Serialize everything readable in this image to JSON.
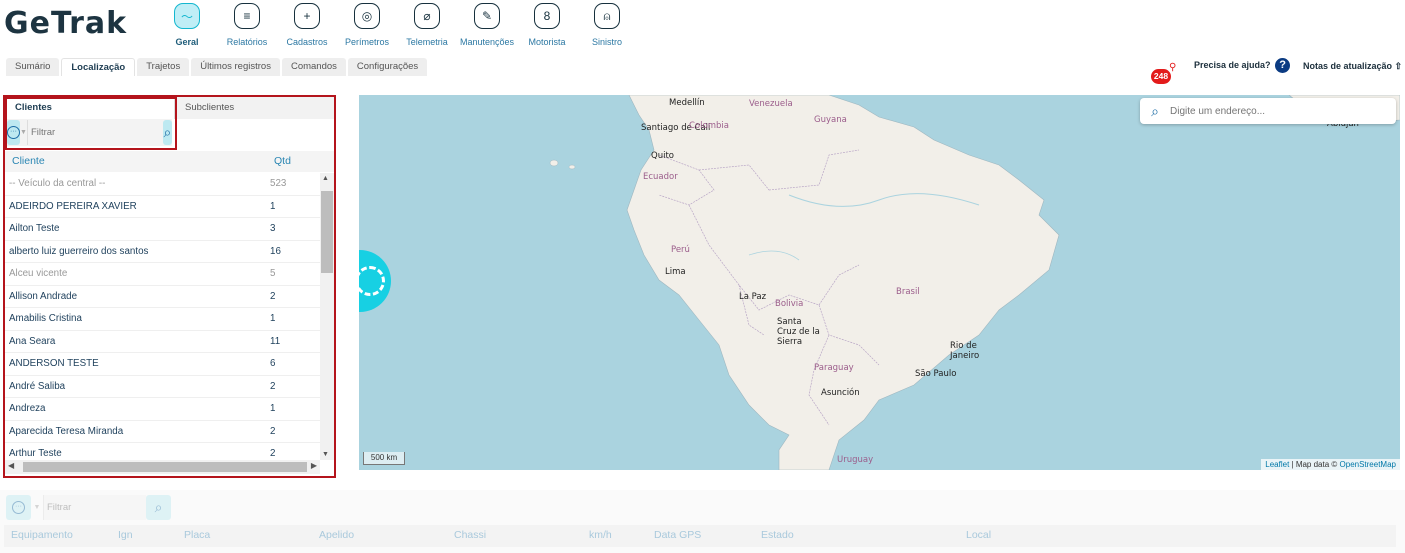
{
  "brand": {
    "logo_text": "GeTrak"
  },
  "nav": [
    {
      "label": "Geral",
      "icon": "dashboard-icon",
      "glyph": "〜",
      "active": true
    },
    {
      "label": "Relatórios",
      "icon": "report-icon",
      "glyph": "≡"
    },
    {
      "label": "Cadastros",
      "icon": "folder-add-icon",
      "glyph": "+"
    },
    {
      "label": "Perímetros",
      "icon": "target-icon",
      "glyph": "◎"
    },
    {
      "label": "Telemetria",
      "icon": "gauge-icon",
      "glyph": "⌀"
    },
    {
      "label": "Manutenções",
      "icon": "wrench-icon",
      "glyph": "✎"
    },
    {
      "label": "Motorista",
      "icon": "driver-icon",
      "glyph": "8"
    },
    {
      "label": "Sinistro",
      "icon": "alarm-icon",
      "glyph": "⍝"
    }
  ],
  "tabs": [
    "Sumário",
    "Localização",
    "Trajetos",
    "Últimos registros",
    "Comandos",
    "Configurações"
  ],
  "active_tab": "Localização",
  "header": {
    "notification_count": "248",
    "help_label": "Precisa de ajuda?",
    "help_glyph": "?",
    "release_notes_label": "Notas de atualização"
  },
  "clients_panel": {
    "tabs": [
      "Clientes",
      "Subclientes"
    ],
    "filter_placeholder": "Filtrar",
    "columns": [
      "Cliente",
      "Qtd"
    ],
    "rows": [
      {
        "name": "-- Veículo da central --",
        "qtd": "523",
        "muted": true
      },
      {
        "name": "ADEIRDO PEREIRA XAVIER",
        "qtd": "1"
      },
      {
        "name": "Ailton Teste",
        "qtd": "3"
      },
      {
        "name": "alberto luiz guerreiro dos santos",
        "qtd": "16"
      },
      {
        "name": "Alceu vicente",
        "qtd": "5",
        "muted": true
      },
      {
        "name": "Allison Andrade",
        "qtd": "2"
      },
      {
        "name": "Amabilis Cristina",
        "qtd": "1"
      },
      {
        "name": "Ana Seara",
        "qtd": "11"
      },
      {
        "name": "ANDERSON TESTE",
        "qtd": "6"
      },
      {
        "name": "André Saliba",
        "qtd": "2"
      },
      {
        "name": "Andreza",
        "qtd": "1"
      },
      {
        "name": "Aparecida Teresa Miranda",
        "qtd": "2"
      },
      {
        "name": "Arthur Teste",
        "qtd": "2"
      }
    ]
  },
  "map": {
    "search_placeholder": "Digite um endereço...",
    "scale_label": "500 km",
    "attribution": {
      "leaflet": "Leaflet",
      "sep": " | Map data © ",
      "osm": "OpenStreetMap"
    },
    "labels": {
      "country": [
        "Venezuela",
        "Guyana",
        "Colombia",
        "Ecuador",
        "Perú",
        "Bolivia",
        "Brasil",
        "Paraguay",
        "Uruguay"
      ],
      "city": [
        "Medellín",
        "Santiago de Cali",
        "Quito",
        "Lima",
        "La Paz",
        "Santa Cruz de la Sierra",
        "Rio de Janeiro",
        "São Paulo",
        "Asunción",
        "Abidjan"
      ]
    },
    "colors": {
      "water": "#aad3df",
      "land": "#f2efe9",
      "cluster": "#17d0e3",
      "accent": "#b4141c"
    }
  },
  "vehicles_table": {
    "filter_placeholder": "Filtrar",
    "columns": [
      "Equipamento",
      "Ign",
      "Placa",
      "Apelido",
      "Chassi",
      "km/h",
      "Data GPS",
      "Estado",
      "Local"
    ]
  }
}
